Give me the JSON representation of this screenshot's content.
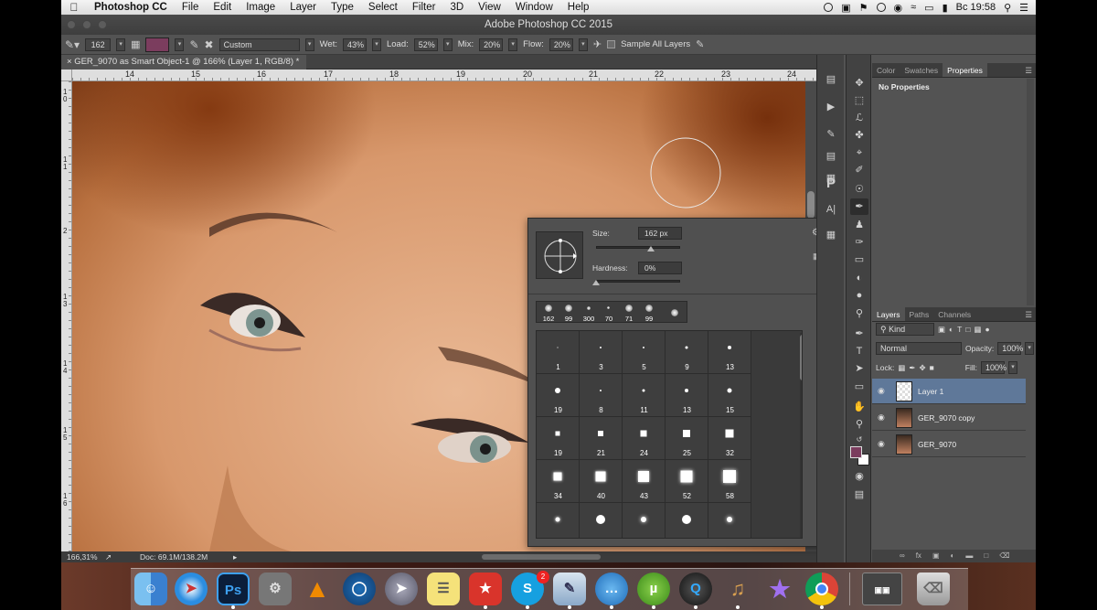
{
  "menubar": {
    "apple": "",
    "app": "Photoshop CC",
    "items": [
      "File",
      "Edit",
      "Image",
      "Layer",
      "Type",
      "Select",
      "Filter",
      "3D",
      "View",
      "Window",
      "Help"
    ],
    "clock": "Вс 19:58"
  },
  "window": {
    "title": "Adobe Photoshop CC 2015"
  },
  "options": {
    "brush_size": "162",
    "mode": "Custom",
    "wet_label": "Wet:",
    "wet": "43%",
    "load_label": "Load:",
    "load": "52%",
    "mix_label": "Mix:",
    "mix": "20%",
    "flow_label": "Flow:",
    "flow": "20%",
    "sample_all": "Sample All Layers",
    "brush_color": "#7b3d5e"
  },
  "document": {
    "tab_title": "GER_9070 as Smart Object-1 @ 166% (Layer 1, RGB/8) *",
    "ruler_h": [
      "14",
      "15",
      "16",
      "17",
      "18",
      "19",
      "20",
      "21",
      "22",
      "23",
      "24"
    ],
    "ruler_v": [
      "1\n0",
      "1\n1",
      "2",
      "1\n3",
      "1\n4",
      "1\n5",
      "1\n6"
    ],
    "zoom": "166,31%",
    "doc_info": "Doc: 69.1M/138.2M"
  },
  "brush_picker": {
    "size_label": "Size:",
    "size_value": "162 px",
    "hardness_label": "Hardness:",
    "hardness_value": "0%",
    "recent": [
      "162",
      "99",
      "300",
      "70",
      "71",
      "99",
      ""
    ],
    "presets": [
      "1",
      "3",
      "5",
      "9",
      "13",
      "19",
      "8",
      "11",
      "13",
      "15",
      "19",
      "21",
      "24",
      "25",
      "32",
      "34",
      "40",
      "43",
      "52",
      "58",
      "",
      "",
      "",
      "",
      ""
    ]
  },
  "right_panel": {
    "top_tabs": [
      "Color",
      "Swatches",
      "Properties"
    ],
    "properties_text": "No Properties",
    "layer_tabs": [
      "Layers",
      "Paths",
      "Channels"
    ],
    "kind_filter": "Kind",
    "blend_mode": "Normal",
    "opacity_label": "Opacity:",
    "opacity": "100%",
    "lock_label": "Lock:",
    "fill_label": "Fill:",
    "fill": "100%",
    "layers": [
      {
        "name": "Layer 1",
        "selected": true
      },
      {
        "name": "GER_9070 copy",
        "selected": false
      },
      {
        "name": "GER_9070",
        "selected": false
      }
    ]
  },
  "tools": [
    "move-tool",
    "marquee-tool",
    "lasso-tool",
    "quick-selection-tool",
    "crop-tool",
    "eyedropper-tool",
    "healing-brush-tool",
    "brush-tool",
    "clone-stamp-tool",
    "history-brush-tool",
    "eraser-tool",
    "paint-bucket-tool",
    "blur-tool",
    "dodge-tool",
    "pen-tool",
    "type-tool",
    "path-selection-tool",
    "rectangle-tool",
    "hand-tool",
    "zoom-tool"
  ],
  "dock": {
    "apps": [
      "Finder",
      "Safari",
      "Photoshop",
      "System Preferences",
      "VLC",
      "1Password",
      "Launchpad",
      "Notes",
      "Wunderlist",
      "Skype",
      "Preview",
      "Messages",
      "uTorrent",
      "QuickTime",
      "Logic",
      "iMovie",
      "Chrome",
      "Screenshot",
      "Trash"
    ],
    "skype_badge": "2"
  }
}
